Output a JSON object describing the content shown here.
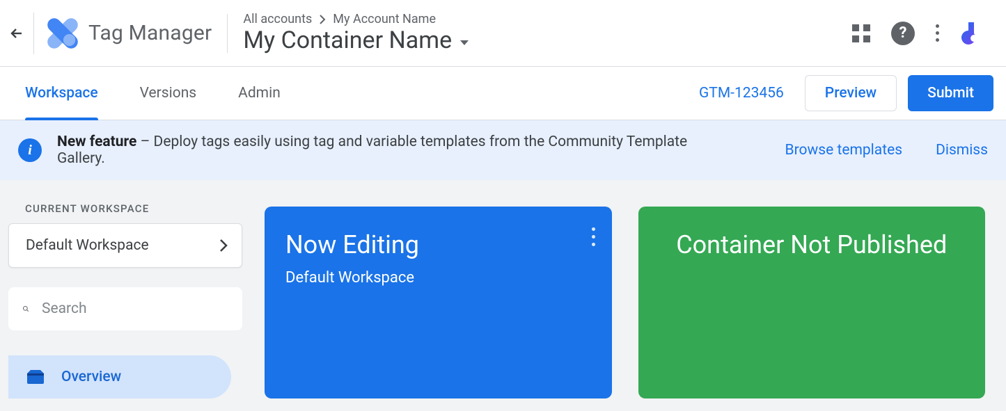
{
  "header": {
    "app_title": "Tag Manager",
    "breadcrumb": {
      "root": "All accounts",
      "account": "My Account Name"
    },
    "container_name": "My Container Name"
  },
  "nav": {
    "tabs": [
      {
        "label": "Workspace",
        "active": true
      },
      {
        "label": "Versions",
        "active": false
      },
      {
        "label": "Admin",
        "active": false
      }
    ],
    "container_id": "GTM-123456",
    "preview_label": "Preview",
    "submit_label": "Submit"
  },
  "banner": {
    "bold": "New feature",
    "text": " – Deploy tags easily using tag and variable templates from the Community Template Gallery.",
    "browse": "Browse templates",
    "dismiss": "Dismiss"
  },
  "sidebar": {
    "section_label": "CURRENT WORKSPACE",
    "workspace_name": "Default Workspace",
    "search_placeholder": "Search",
    "items": [
      {
        "label": "Overview",
        "active": true
      }
    ]
  },
  "cards": {
    "editing": {
      "title": "Now Editing",
      "subtitle": "Default Workspace"
    },
    "publish": {
      "title": "Container Not Published"
    }
  },
  "colors": {
    "primary": "#1a73e8",
    "green": "#34a853"
  }
}
